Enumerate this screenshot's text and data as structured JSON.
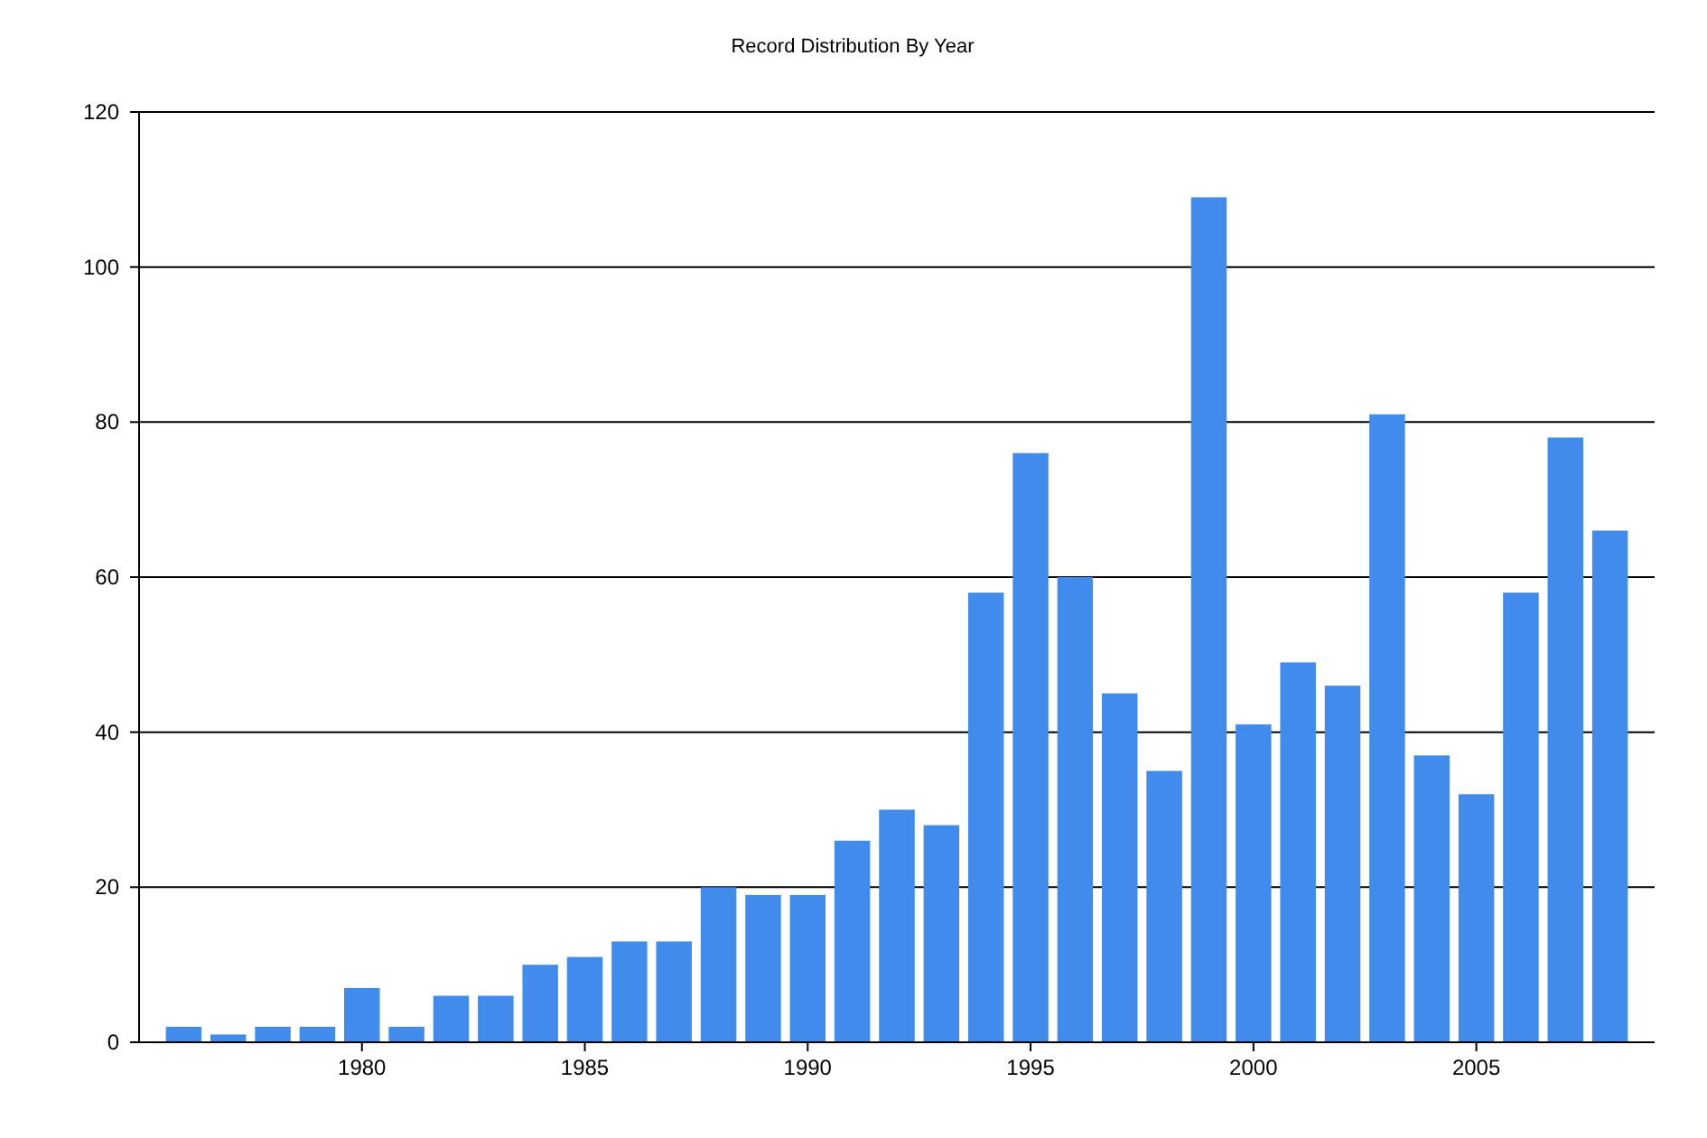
{
  "chart": {
    "chart_data": {
      "type": "bar",
      "title": "Record Distribution By Year",
      "x": [
        1976,
        1977,
        1978,
        1979,
        1980,
        1981,
        1982,
        1983,
        1984,
        1985,
        1986,
        1987,
        1988,
        1989,
        1990,
        1991,
        1992,
        1993,
        1994,
        1995,
        1996,
        1997,
        1998,
        1999,
        2000,
        2001,
        2002,
        2003,
        2004,
        2005,
        2006,
        2007,
        2008
      ],
      "grid": true,
      "series": [
        {
          "color": "#418bed",
          "values": [
            2,
            1,
            2,
            2,
            7,
            2,
            6,
            6,
            10,
            11,
            13,
            13,
            20,
            19,
            19,
            26,
            30,
            28,
            58,
            76,
            60,
            45,
            35,
            109,
            41,
            49,
            46,
            81,
            37,
            32,
            58,
            78,
            66
          ]
        }
      ],
      "xlim": [
        1975,
        2009
      ],
      "ylim": [
        0,
        120
      ],
      "xticks": [
        1980,
        1985,
        1990,
        1995,
        2000,
        2005
      ],
      "yticks": [
        0,
        20,
        40,
        60,
        80,
        100,
        120
      ]
    }
  }
}
